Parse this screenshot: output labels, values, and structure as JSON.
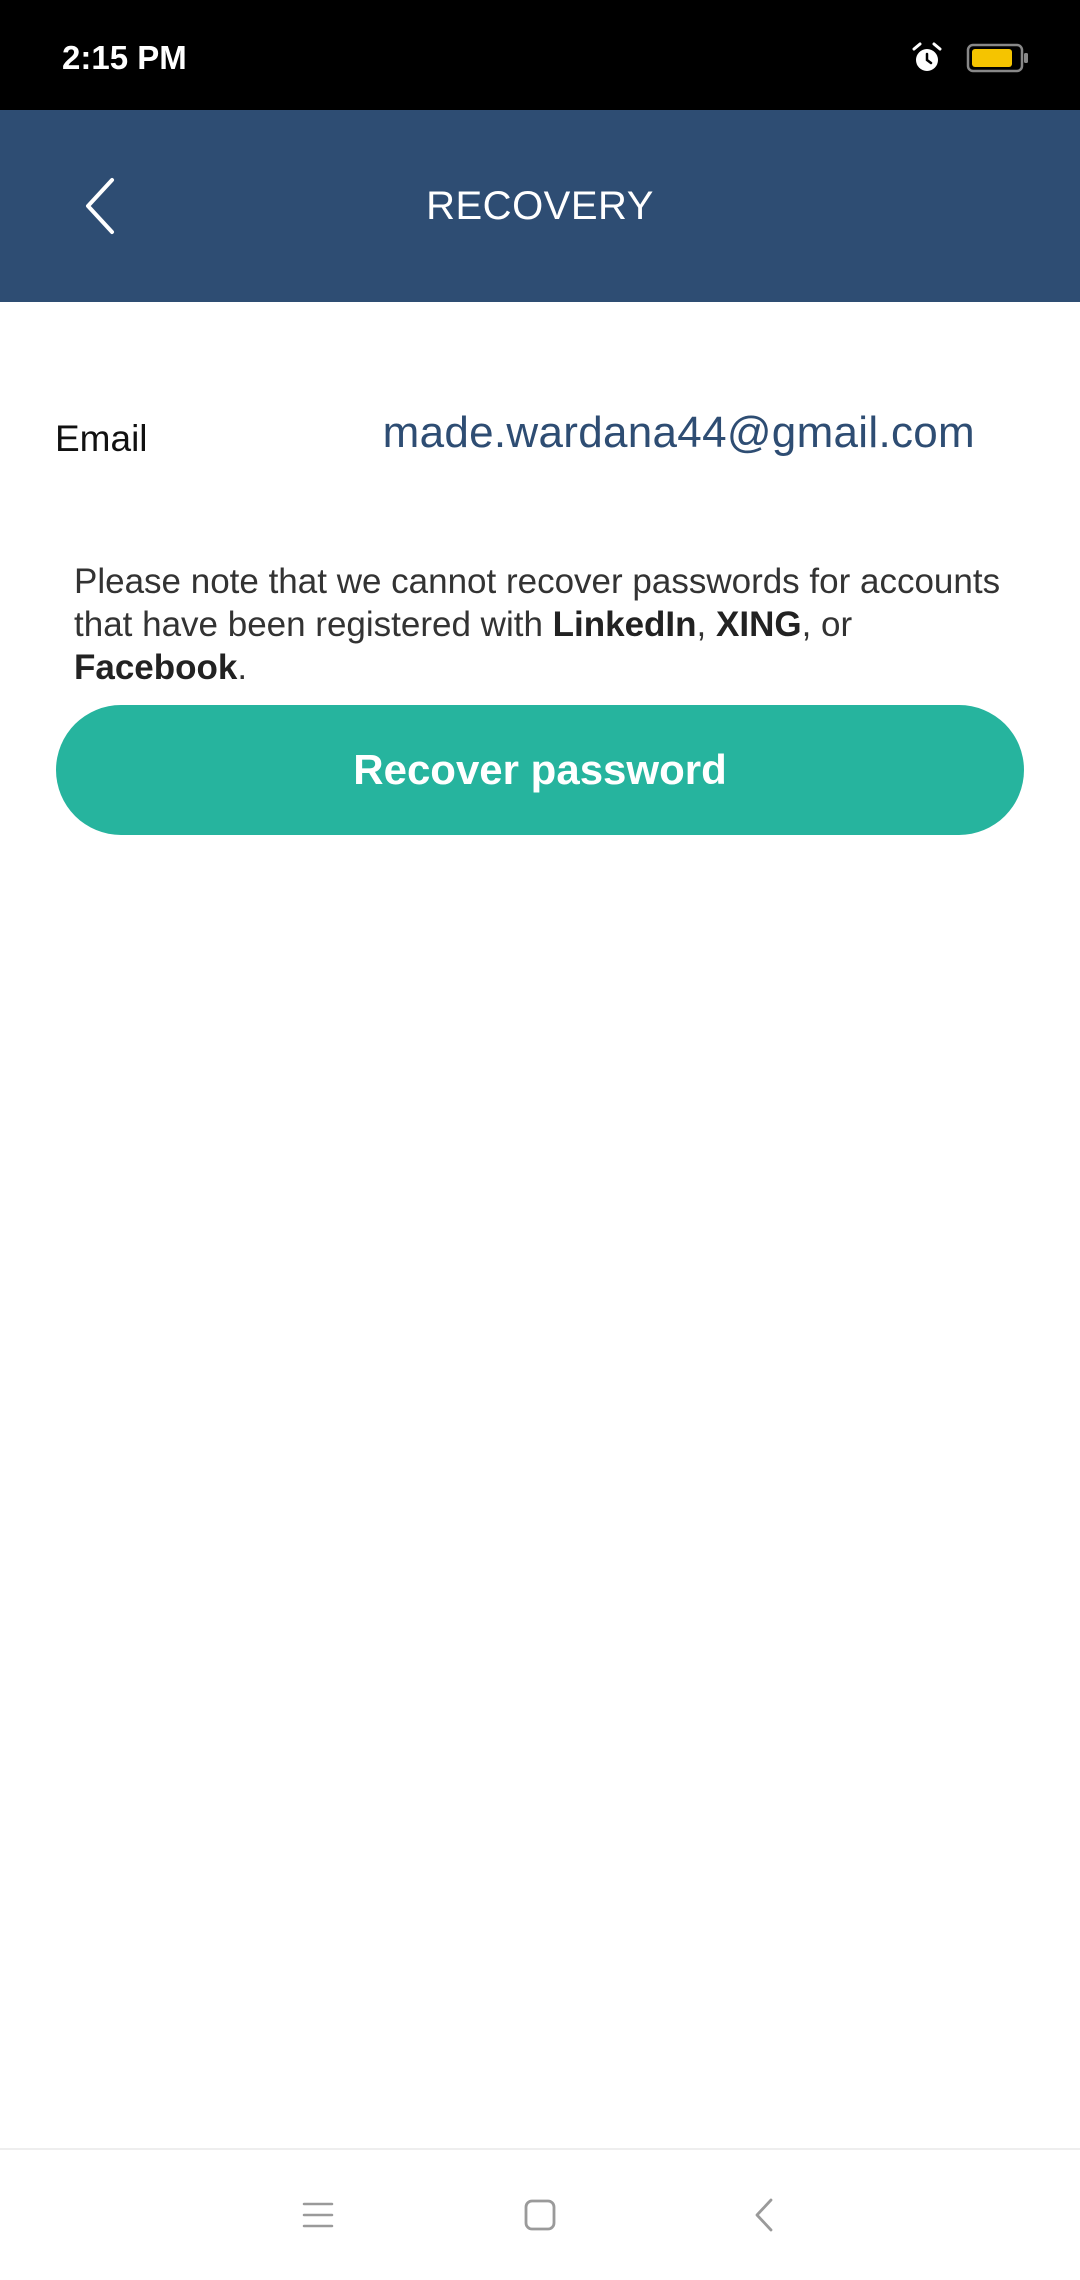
{
  "status_bar": {
    "time": "2:15 PM",
    "icons": [
      "alarm-icon",
      "battery-icon"
    ],
    "battery_color": "#f5c400"
  },
  "header": {
    "title": "RECOVERY",
    "back_icon": "chevron-left-icon",
    "background": "#2e4d73"
  },
  "form": {
    "email_label": "Email",
    "email_value": "made.wardana44@gmail.com"
  },
  "notice": {
    "text_before": "Please note that we cannot recover passwords for accounts that have been registered with ",
    "provider_1": "LinkedIn",
    "sep_1": ", ",
    "provider_2": "XING",
    "sep_2": ", or ",
    "provider_3": "Facebook",
    "text_after": "."
  },
  "recover_button": {
    "label": "Recover password",
    "color": "#26b49e"
  },
  "nav_bar": {
    "items": [
      "menu-icon",
      "home-square-icon",
      "back-chevron-icon"
    ]
  }
}
